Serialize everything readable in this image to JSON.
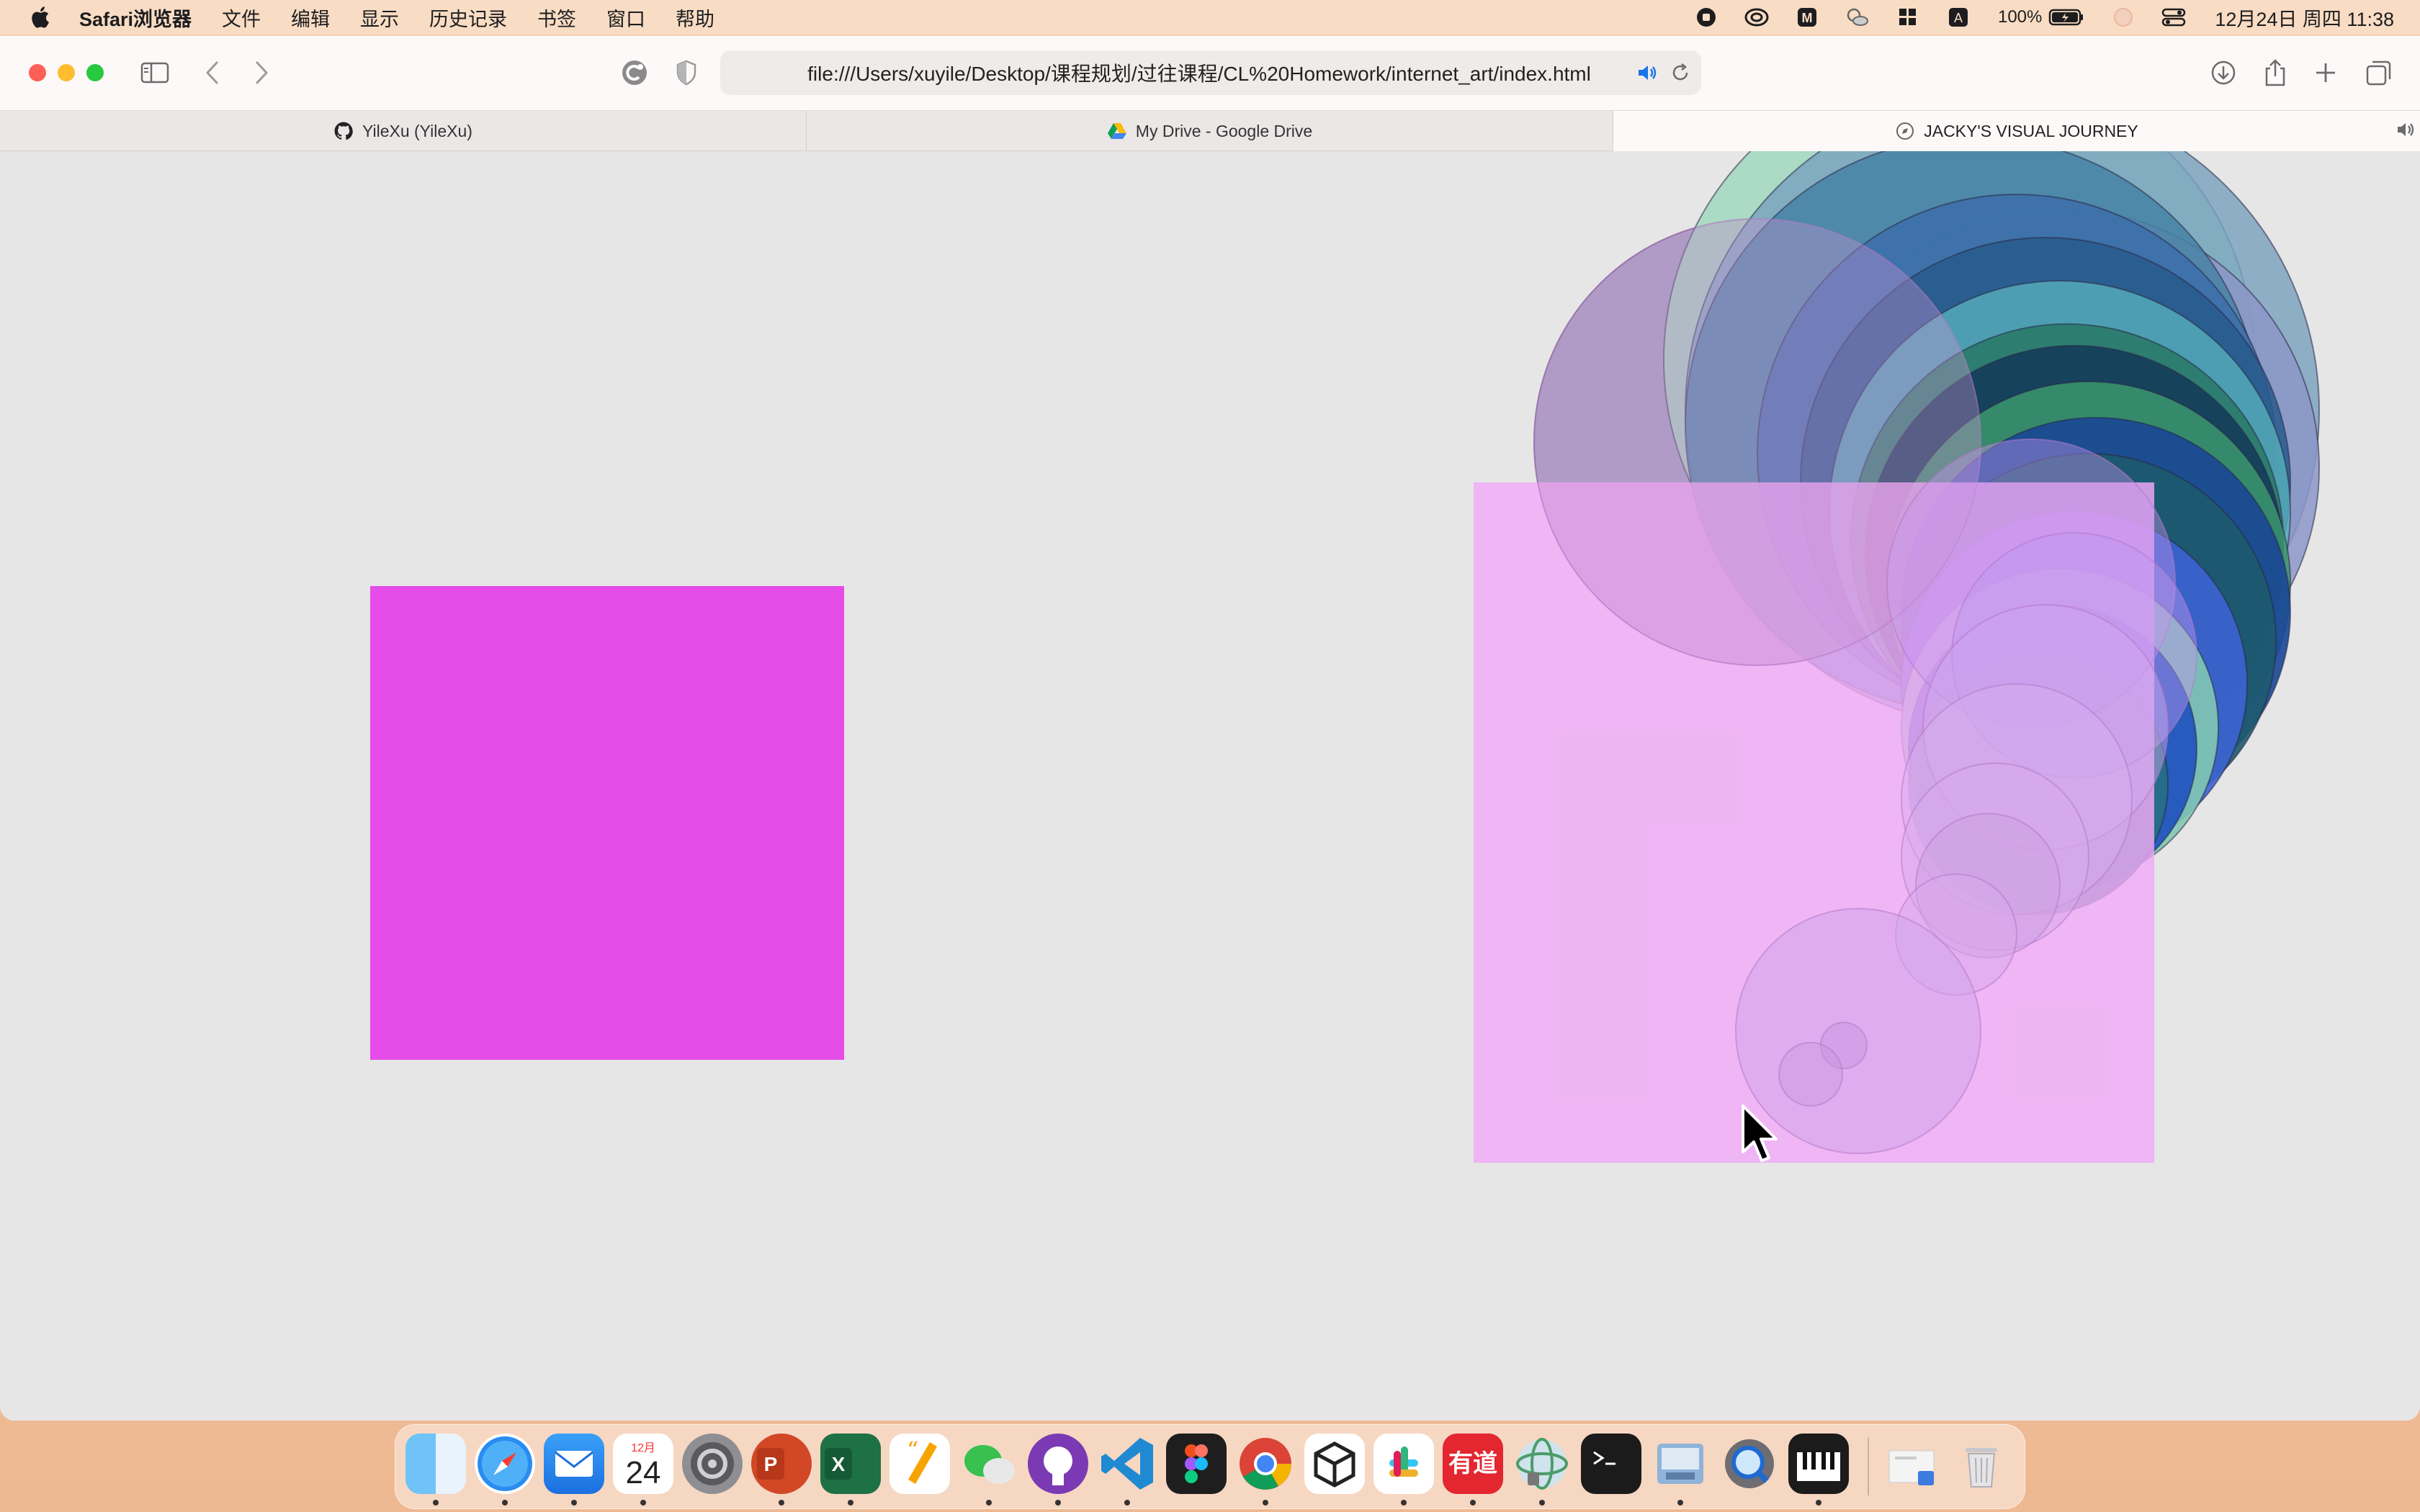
{
  "menubar": {
    "app_name": "Safari浏览器",
    "items": [
      "文件",
      "编辑",
      "显示",
      "历史记录",
      "书签",
      "窗口",
      "帮助"
    ],
    "battery": "100%",
    "clock": "12月24日 周四  11:38",
    "status_icons": [
      "record-icon",
      "creative-cloud-icon",
      "m-icon",
      "weather-icon",
      "grid-icon",
      "input-method-icon",
      "battery-icon",
      "siri-icon",
      "control-center-icon"
    ]
  },
  "browser": {
    "url": "file:///Users/xuyile/Desktop/课程规划/过往课程/CL%20Homework/internet_art/index.html",
    "tabs": [
      {
        "label": "YileXu (YileXu)",
        "icon": "github-icon",
        "active": false
      },
      {
        "label": "My Drive - Google Drive",
        "icon": "google-drive-icon",
        "active": false
      },
      {
        "label": "JACKY'S VISUAL JOURNEY",
        "icon": "compass-icon",
        "active": true
      }
    ]
  },
  "art": {
    "square_color": "#e54ce8",
    "overlay_color": "#f0b4f5"
  },
  "dock": {
    "apps": [
      "finder",
      "safari",
      "mail",
      "calendar",
      "system-preferences",
      "powerpoint",
      "excel",
      "pages",
      "wechat",
      "github-desktop",
      "vscode",
      "figma",
      "chrome",
      "unity",
      "slack",
      "youdao",
      "network-utility",
      "terminal",
      "preview",
      "quicktime",
      "piano",
      "downloads",
      "trash"
    ],
    "calendar_month": "12月",
    "calendar_day": "24",
    "youdao_label": "有道"
  }
}
